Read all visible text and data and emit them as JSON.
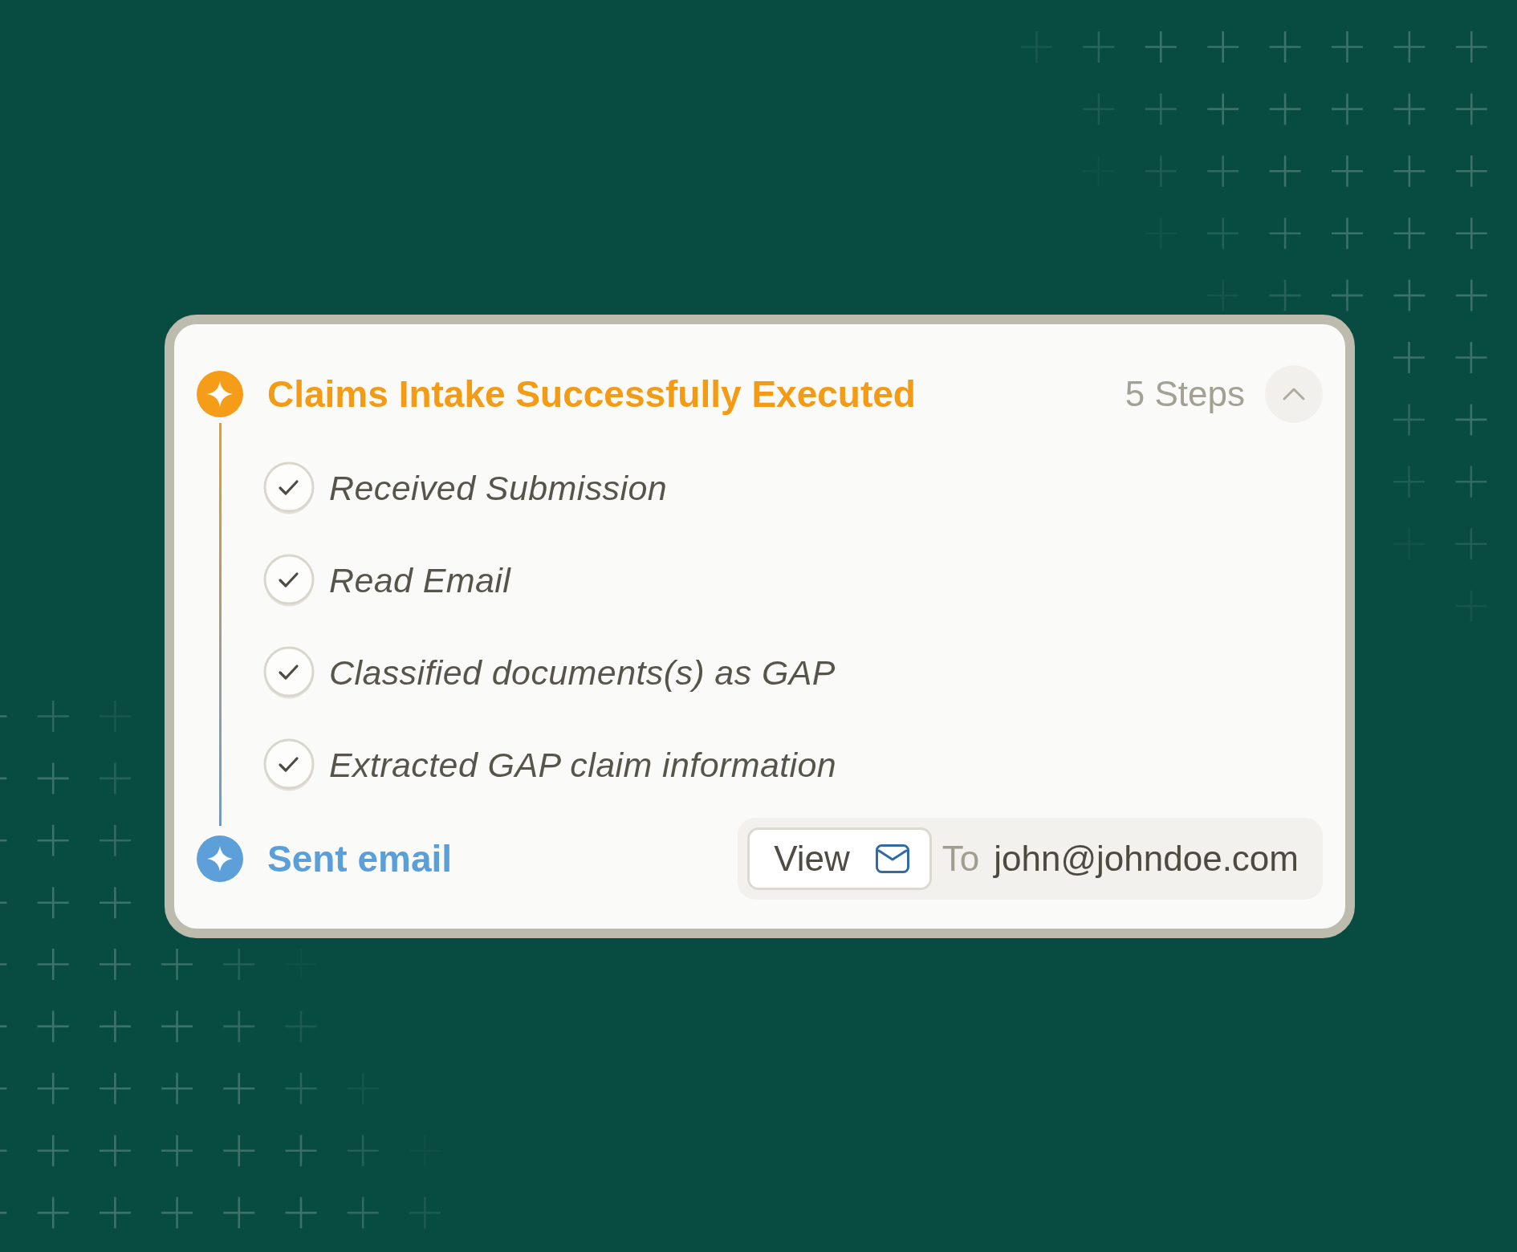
{
  "header": {
    "title": "Claims Intake Successfully Executed",
    "step_count": "5 Steps",
    "expanded": true
  },
  "steps": [
    {
      "label": "Received Submission",
      "done": true
    },
    {
      "label": "Read Email",
      "done": true
    },
    {
      "label": "Classified documents(s) as GAP",
      "done": true
    },
    {
      "label": "Extracted GAP claim information",
      "done": true
    }
  ],
  "final_step": {
    "label": "Sent email",
    "button": "View",
    "recipient_prefix": "To",
    "recipient": "john@johndoe.com"
  }
}
